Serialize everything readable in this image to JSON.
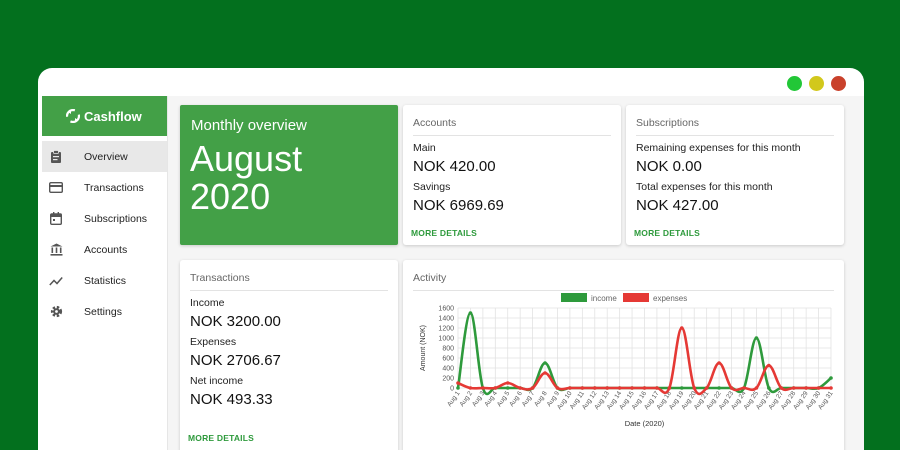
{
  "colors": {
    "background": "#03701e",
    "brand": "#43a047",
    "income": "#2e9a3c",
    "expenses": "#e53935",
    "dot_green": "#22c737",
    "dot_yellow": "#d2c81c",
    "dot_red": "#c9412b"
  },
  "sidebar": {
    "brand": {
      "title": "Cashflow",
      "icon": "cashflow-logo-icon"
    },
    "items": [
      {
        "label": "Overview",
        "icon": "clipboard-icon",
        "active": true
      },
      {
        "label": "Transactions",
        "icon": "credit-card-icon",
        "active": false
      },
      {
        "label": "Subscriptions",
        "icon": "calendar-icon",
        "active": false
      },
      {
        "label": "Accounts",
        "icon": "bank-icon",
        "active": false
      },
      {
        "label": "Statistics",
        "icon": "trending-icon",
        "active": false
      },
      {
        "label": "Settings",
        "icon": "gear-icon",
        "active": false
      }
    ]
  },
  "overview": {
    "label": "Monthly overview",
    "month": "August",
    "year": "2020"
  },
  "accounts": {
    "title": "Accounts",
    "items": [
      {
        "label": "Main",
        "value": "NOK 420.00"
      },
      {
        "label": "Savings",
        "value": "NOK 6969.69"
      }
    ],
    "more": "MORE DETAILS"
  },
  "subscriptions": {
    "title": "Subscriptions",
    "items": [
      {
        "label": "Remaining expenses for this month",
        "value": "NOK 0.00"
      },
      {
        "label": "Total expenses for this month",
        "value": "NOK 427.00"
      }
    ],
    "more": "MORE DETAILS"
  },
  "transactions": {
    "title": "Transactions",
    "items": [
      {
        "label": "Income",
        "value": "NOK 3200.00"
      },
      {
        "label": "Expenses",
        "value": "NOK 2706.67"
      },
      {
        "label": "Net income",
        "value": "NOK 493.33"
      }
    ],
    "more": "MORE DETAILS"
  },
  "activity": {
    "title": "Activity",
    "chart_data": {
      "type": "line",
      "xlabel": "Date (2020)",
      "ylabel": "Amount (NOK)",
      "ylim": [
        0,
        1600
      ],
      "yticks": [
        0,
        200,
        400,
        600,
        800,
        1000,
        1200,
        1400,
        1600
      ],
      "grid": true,
      "legend": "top",
      "categories": [
        "Aug 1",
        "Aug 2",
        "Aug 3",
        "Aug 4",
        "Aug 5",
        "Aug 6",
        "Aug 7",
        "Aug 8",
        "Aug 9",
        "Aug 10",
        "Aug 11",
        "Aug 12",
        "Aug 13",
        "Aug 14",
        "Aug 15",
        "Aug 16",
        "Aug 17",
        "Aug 18",
        "Aug 19",
        "Aug 20",
        "Aug 21",
        "Aug 22",
        "Aug 23",
        "Aug 24",
        "Aug 25",
        "Aug 26",
        "Aug 27",
        "Aug 28",
        "Aug 29",
        "Aug 30",
        "Aug 31"
      ],
      "series": [
        {
          "name": "income",
          "color": "#2e9a3c",
          "values": [
            0,
            1500,
            0,
            0,
            0,
            0,
            0,
            500,
            0,
            0,
            0,
            0,
            0,
            0,
            0,
            0,
            0,
            0,
            0,
            0,
            0,
            0,
            0,
            0,
            1000,
            0,
            0,
            0,
            0,
            0,
            200
          ]
        },
        {
          "name": "expenses",
          "color": "#e53935",
          "values": [
            100,
            0,
            0,
            0,
            100,
            0,
            0,
            300,
            0,
            0,
            0,
            0,
            0,
            0,
            0,
            0,
            0,
            0,
            1200,
            0,
            0,
            500,
            0,
            0,
            0,
            450,
            0,
            0,
            0,
            0,
            0
          ]
        }
      ]
    }
  }
}
